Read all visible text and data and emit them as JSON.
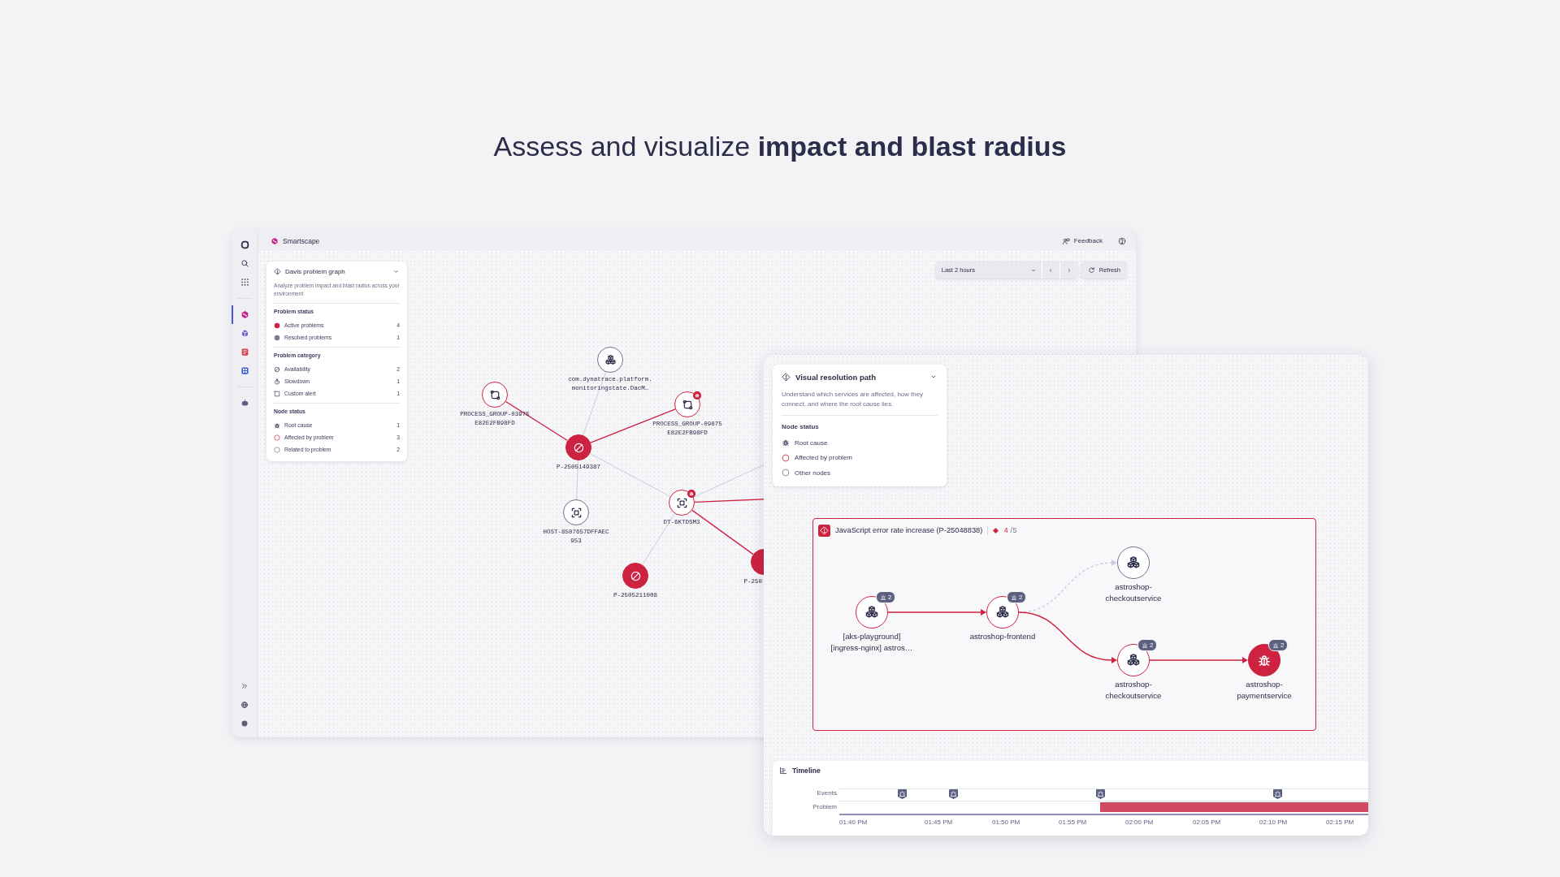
{
  "headline": "Assess and visualize **impact and blast radius**",
  "smartscape_window": {
    "app_title": "Smartscape",
    "feedback": "Feedback",
    "sidebar": {
      "items": [
        {
          "selected": false
        },
        {
          "selected": false
        },
        {
          "selected": false
        },
        {
          "selected": true
        },
        {
          "selected": false
        },
        {
          "selected": false
        },
        {
          "selected": false
        },
        {
          "selected": false
        }
      ]
    },
    "timeframe": {
      "value": "Last 2 hours"
    },
    "refresh": "Refresh",
    "panel": {
      "title": "Davis problem graph",
      "description": "Analyze problem impact and blast radius across your environment",
      "sections": [
        {
          "title": "Problem status",
          "items": [
            {
              "kind": "active",
              "label": "Active problems",
              "count": "4"
            },
            {
              "kind": "resolved",
              "label": "Resolved problems",
              "count": "1"
            }
          ]
        },
        {
          "title": "Problem category",
          "items": [
            {
              "kind": "availability",
              "label": "Availability",
              "count": "2"
            },
            {
              "kind": "slowdown",
              "label": "Slowdown",
              "count": "1"
            },
            {
              "kind": "custom_alert",
              "label": "Custom alert",
              "count": "1"
            }
          ]
        },
        {
          "title": "Node status",
          "items": [
            {
              "kind": "root_cause",
              "label": "Root cause",
              "count": "1"
            },
            {
              "kind": "affected",
              "label": "Affected by problem",
              "count": "3"
            },
            {
              "kind": "related",
              "label": "Related to problem",
              "count": "2"
            }
          ]
        }
      ]
    },
    "graph": {
      "nodes": [
        {
          "kind": "service",
          "affected": false,
          "badge": false,
          "label": "com.dynatrace.platform.\nmonitoringstate.DacM…"
        },
        {
          "kind": "process_group",
          "affected": true,
          "badge": false,
          "label": "PROCESS_GROUP-03975\nE82E2FB98FD"
        },
        {
          "kind": "problem",
          "badge": false,
          "label": "P-2505149387"
        },
        {
          "kind": "process_group",
          "affected": true,
          "badge": true,
          "label": "PROCESS_GROUP-09875\nE82E2FB98FD"
        },
        {
          "kind": "host",
          "affected": false,
          "badge": false,
          "label": "HOST-8507657DFFAEC\n953"
        },
        {
          "kind": "host",
          "affected": true,
          "badge": true,
          "label": "DT-6KTDSM3"
        },
        {
          "kind": "problem",
          "badge": false,
          "label": "P-2505211008"
        },
        {
          "kind": "problem",
          "badge": false,
          "label": "P-250"
        }
      ],
      "edges": [
        {
          "affected": true
        },
        {
          "affected": true
        },
        {
          "affected": false
        },
        {
          "affected": false
        },
        {
          "affected": false
        },
        {
          "affected": false
        },
        {
          "affected": true
        },
        {
          "affected": true
        },
        {
          "affected": false
        }
      ]
    }
  },
  "resolution_window": {
    "panel": {
      "title": "Visual resolution path",
      "description": "Understand which services are affected, how they connect, and where the root cause lies.",
      "section": "Node status",
      "items": [
        {
          "kind": "root_cause",
          "label": "Root cause"
        },
        {
          "kind": "affected",
          "label": "Affected by problem"
        },
        {
          "kind": "other",
          "label": "Other nodes"
        }
      ]
    },
    "problem": {
      "title": "JavaScript error rate increase (P-25048838)",
      "score": "4",
      "of": "/5",
      "nodes": [
        {
          "kind": "service",
          "affected": true,
          "alerts": "2",
          "label": "[aks-playground]\n[ingress-nginx] astros…"
        },
        {
          "kind": "service",
          "affected": true,
          "alerts": "2",
          "label": "astroshop-frontend"
        },
        {
          "kind": "service",
          "affected": false,
          "label": "astroshop-\ncheckoutservice"
        },
        {
          "kind": "service",
          "affected": true,
          "alerts": "2",
          "label": "astroshop-\ncheckoutservice"
        },
        {
          "kind": "root_cause",
          "alerts": "2",
          "label": "astroshop-\npaymentservice"
        }
      ],
      "edges": [
        {
          "affected": true
        },
        {
          "affected": false
        },
        {
          "affected": true
        },
        {
          "affected": true
        }
      ]
    },
    "timeline": {
      "title": "Timeline",
      "rows": [
        "Events",
        "Problem"
      ],
      "ticks": [
        "01:40 PM",
        "01:45 PM",
        "01:50 PM",
        "01:55 PM",
        "02:00 PM",
        "02:05 PM",
        "02:10 PM",
        "02:15 PM"
      ]
    }
  }
}
